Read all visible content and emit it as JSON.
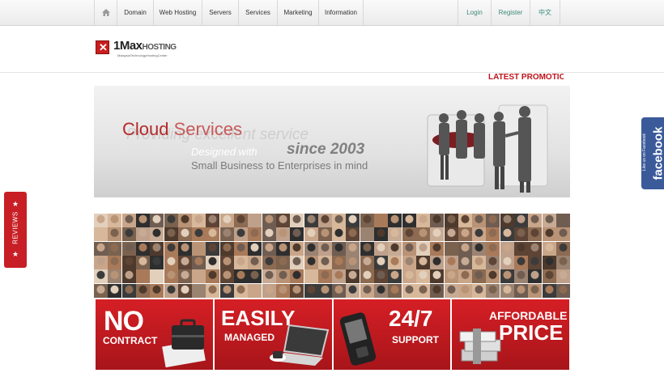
{
  "nav": {
    "items": [
      "Domain",
      "Web Hosting",
      "Servers",
      "Services",
      "Marketing",
      "Information"
    ],
    "login": "Login",
    "register": "Register",
    "lang": "中文",
    "home_icon": "home-icon"
  },
  "logo": {
    "brand_number": "1",
    "brand_max": "Max",
    "brand_hosting": "HOSTING",
    "tagline": "MalaysiaTechnologyHostingCenter"
  },
  "promo": {
    "label": "LATEST PROMOTIO"
  },
  "banner": {
    "ghost": "Providing excellent service",
    "title_a": "Cloud",
    "title_b": " Services",
    "designed": "Designed with",
    "since": "since 2003",
    "small": "Small Business to Enterprises in mind"
  },
  "features": {
    "f1a": "NO",
    "f1b": "CONTRACT",
    "f2a": "EASILY",
    "f2b": "MANAGED",
    "f3a": "24/7",
    "f3b": "SUPPORT",
    "f4a": "AFFORDABLE",
    "f4b": "PRICE"
  },
  "side": {
    "reviews": "REVIEWS",
    "fb_small": "Like us on Facebook",
    "fb_big": "facebook"
  },
  "colors": {
    "accent": "#c71f25",
    "facebook": "#3b5a9a",
    "nav_link": "#3a8a78"
  }
}
